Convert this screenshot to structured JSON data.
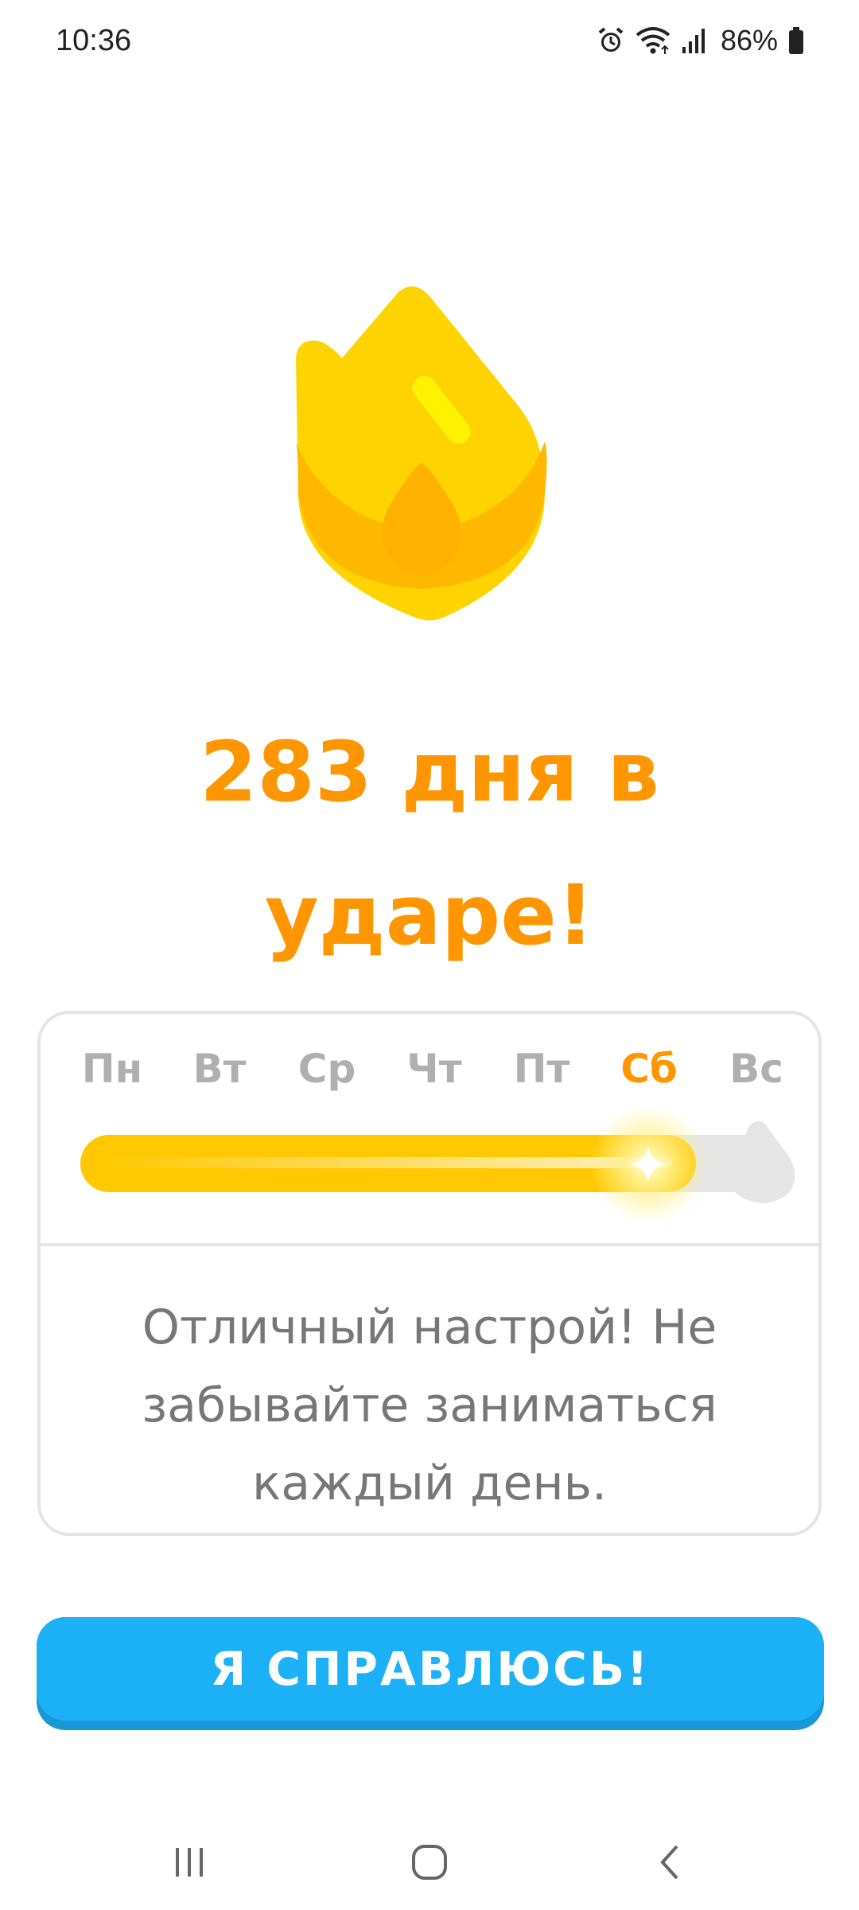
{
  "status_bar": {
    "time": "10:36",
    "battery": "86%",
    "icons": [
      "alarm-icon",
      "wifi-icon",
      "signal-icon",
      "battery-icon"
    ]
  },
  "streak": {
    "headline_line1": "283 дня в",
    "headline_line2": "ударе!",
    "days": [
      "Пн",
      "Вт",
      "Ср",
      "Чт",
      "Пт",
      "Сб",
      "Вс"
    ],
    "current_day_index": 5,
    "week_progress": 0.89,
    "message": "Отличный настрой! Не забывайте заниматься каждый день."
  },
  "cta": {
    "label": "Я СПРАВЛЮСЬ!"
  },
  "nav": {
    "icons": [
      "recent-apps-icon",
      "home-icon",
      "back-icon"
    ]
  },
  "colors": {
    "accent_orange": "#ff9600",
    "flame_yellow": "#ffc800",
    "button_blue": "#1cb0f6",
    "button_shadow": "#1899d6",
    "muted_gray": "#afafaf",
    "border_gray": "#e5e5e5"
  }
}
